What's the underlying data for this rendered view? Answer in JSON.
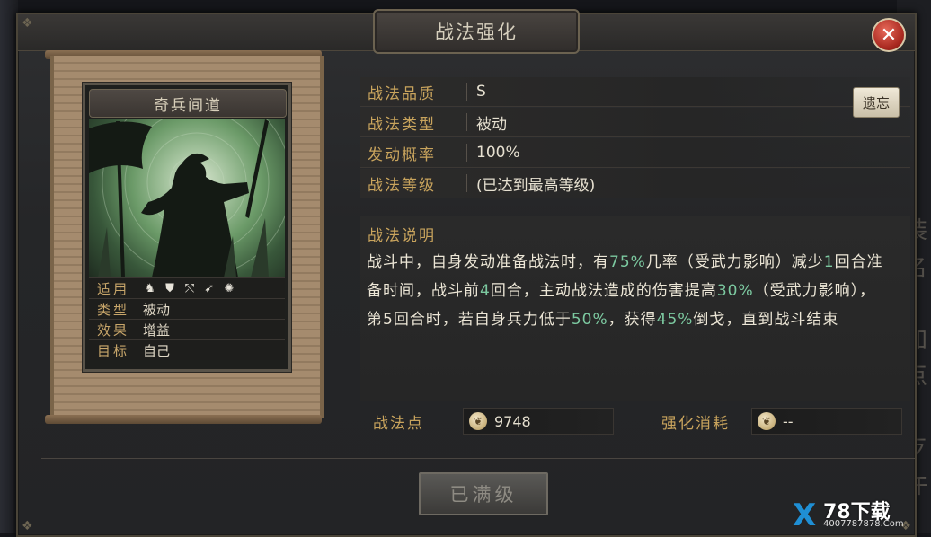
{
  "window": {
    "title": "战法强化",
    "close_icon": "close-icon"
  },
  "card": {
    "name": "奇兵间道",
    "rows": [
      {
        "label": "适用",
        "value": "",
        "icons": [
          "cavalry-icon",
          "shield-icon",
          "bow-icon",
          "spear-icon",
          "chariot-icon"
        ]
      },
      {
        "label": "类型",
        "value": "被动"
      },
      {
        "label": "效果",
        "value": "增益"
      },
      {
        "label": "目标",
        "value": "自己"
      }
    ]
  },
  "attributes": [
    {
      "label": "战法品质",
      "value": "S"
    },
    {
      "label": "战法类型",
      "value": "被动"
    },
    {
      "label": "发动概率",
      "value": "100%"
    },
    {
      "label": "战法等级",
      "value": "(已达到最高等级)"
    }
  ],
  "preview_button": "遗忘",
  "description": {
    "label": "战法说明",
    "segments": [
      {
        "text": "战斗中，自身发动准备战法时，有",
        "hl": false
      },
      {
        "text": "75%",
        "hl": true
      },
      {
        "text": "几率（受武力影响）减少",
        "hl": false
      },
      {
        "text": "1",
        "hl": true
      },
      {
        "text": "回合准备时间，战斗前",
        "hl": false
      },
      {
        "text": "4",
        "hl": true
      },
      {
        "text": "回合，主动战法造成的伤害提高",
        "hl": false
      },
      {
        "text": "30%",
        "hl": true
      },
      {
        "text": "（受武力影响），第5回合时，若自身兵力低于",
        "hl": false
      },
      {
        "text": "50%",
        "hl": true
      },
      {
        "text": "，获得",
        "hl": false
      },
      {
        "text": "45%",
        "hl": true
      },
      {
        "text": "倒戈，直到战斗结束",
        "hl": false
      }
    ],
    "highlight_color": "#7cc9a0"
  },
  "points": {
    "label": "战法点",
    "value": "9748",
    "icon": "feather-icon"
  },
  "cost": {
    "label": "强化消耗",
    "value": "--",
    "icon": "feather-icon"
  },
  "action_button": "已满级",
  "side_text": [
    "讠",
    "忄",
    "装",
    "名",
    "加",
    "点",
    "歹",
    "仵"
  ],
  "watermark": {
    "main": "78下载",
    "sub": "4007787878.Com"
  }
}
